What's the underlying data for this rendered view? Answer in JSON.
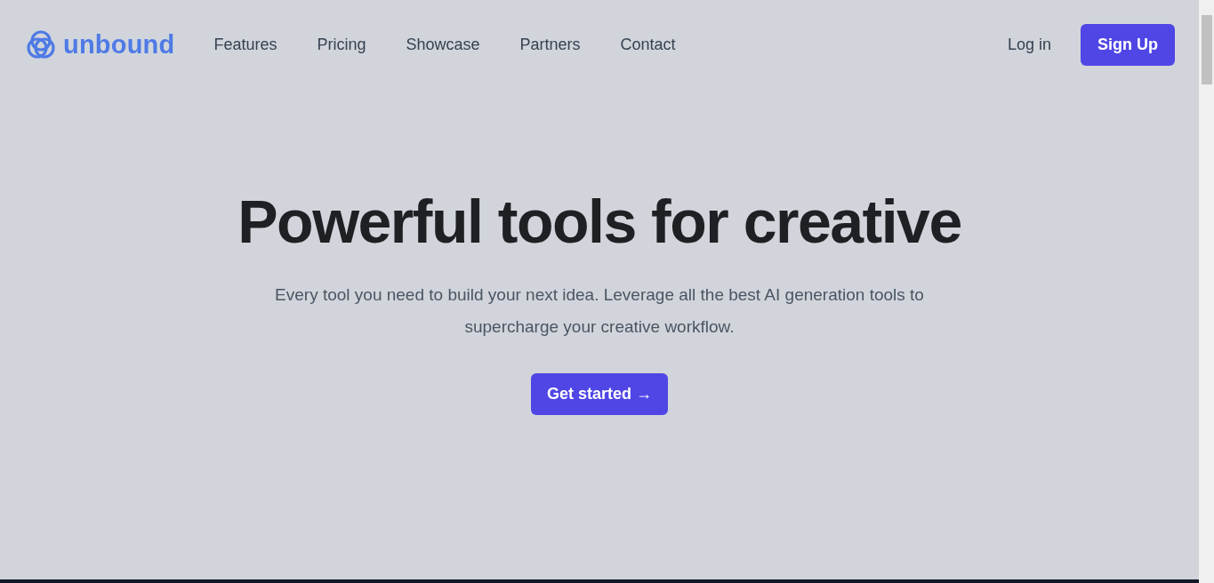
{
  "brand": {
    "name": "unbound"
  },
  "nav": {
    "links": [
      {
        "label": "Features"
      },
      {
        "label": "Pricing"
      },
      {
        "label": "Showcase"
      },
      {
        "label": "Partners"
      },
      {
        "label": "Contact"
      }
    ],
    "login": "Log in",
    "signup": "Sign Up"
  },
  "hero": {
    "title": "Powerful tools for creative",
    "subtitle": "Every tool you need to build your next idea. Leverage all the best AI generation tools to supercharge your creative workflow.",
    "cta": "Get started →"
  }
}
